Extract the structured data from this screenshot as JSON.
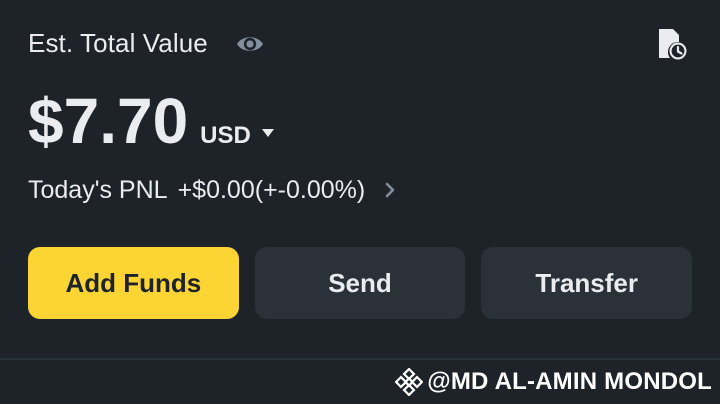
{
  "header": {
    "title": "Est. Total Value",
    "visibility_icon": "eye-icon",
    "history_icon": "document-clock-icon"
  },
  "balance": {
    "amount": "$7.70",
    "currency": "USD",
    "currency_dropdown_icon": "caret-down-icon"
  },
  "pnl": {
    "label": "Today's PNL",
    "value": "+$0.00(+-0.00%)",
    "chevron_icon": "chevron-right-icon"
  },
  "actions": {
    "add_funds": "Add Funds",
    "send": "Send",
    "transfer": "Transfer"
  },
  "watermark": {
    "logo_icon": "binance-logo-icon",
    "text": "@MD AL-AMIN MONDOL"
  },
  "colors": {
    "background": "#1e2329",
    "primary_text": "#eaecef",
    "secondary_text": "#848e9c",
    "accent_yellow": "#fcd535",
    "button_dark": "#2b3139"
  }
}
